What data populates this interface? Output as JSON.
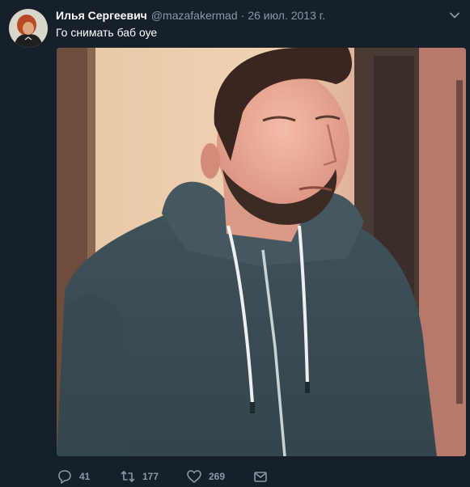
{
  "tweet": {
    "display_name": "Илья Сергеевич",
    "handle": "@mazafakermad",
    "separator": "·",
    "date": "26 июл. 2013 г.",
    "text": "Го снимать баб оуе"
  },
  "actions": {
    "reply_count": "41",
    "retweet_count": "177",
    "like_count": "269"
  },
  "colors": {
    "background": "#15202b",
    "secondary_text": "#8899a6",
    "primary_text": "#ffffff"
  },
  "icons": {
    "caret": "chevron-down-icon",
    "reply": "reply-icon",
    "retweet": "retweet-icon",
    "like": "heart-icon",
    "message": "envelope-icon"
  }
}
